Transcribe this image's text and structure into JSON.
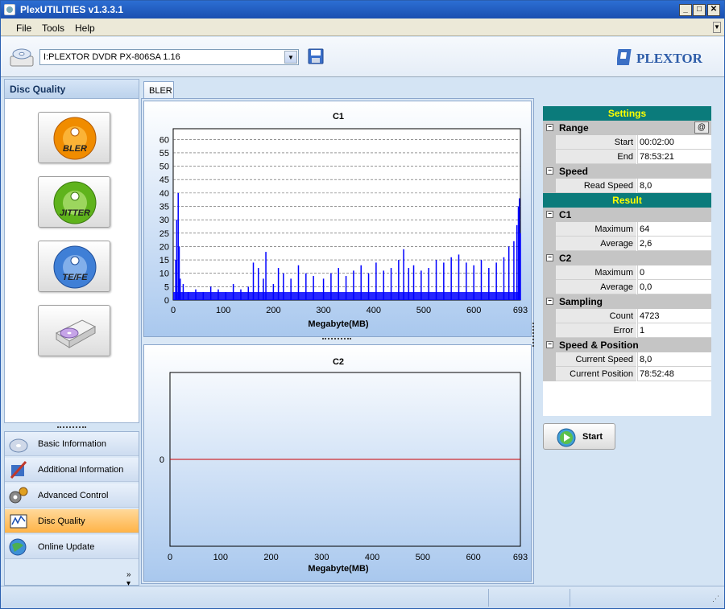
{
  "window": {
    "title": "PlexUTILITIES v1.3.3.1"
  },
  "menu": [
    "File",
    "Tools",
    "Help"
  ],
  "toolbar": {
    "drive": "I:PLEXTOR DVDR   PX-806SA   1.16",
    "logo_text": "PLEXTOR"
  },
  "left": {
    "header": "Disc Quality",
    "tests": [
      "BLER",
      "JITTER",
      "TE/FE"
    ],
    "nav": [
      {
        "label": "Basic Information",
        "icon": "cd-info-icon"
      },
      {
        "label": "Additional Information",
        "icon": "tools-icon"
      },
      {
        "label": "Advanced Control",
        "icon": "gears-icon"
      },
      {
        "label": "Disc Quality",
        "icon": "chart-icon",
        "active": true
      },
      {
        "label": "Online Update",
        "icon": "globe-icon"
      }
    ]
  },
  "tab": "BLER",
  "chart_data": [
    {
      "type": "bar",
      "title": "C1",
      "xlabel": "Megabyte(MB)",
      "ylabel": "",
      "xlim": [
        0,
        693
      ],
      "ylim": [
        0,
        64
      ],
      "xticks": [
        0,
        100,
        200,
        300,
        400,
        500,
        600,
        693
      ],
      "yticks": [
        0,
        5,
        10,
        15,
        20,
        25,
        30,
        35,
        40,
        45,
        50,
        55,
        60
      ],
      "grid": true,
      "color": "#0000ff",
      "spikes": [
        {
          "x": 5,
          "y": 15
        },
        {
          "x": 7,
          "y": 30
        },
        {
          "x": 10,
          "y": 40
        },
        {
          "x": 12,
          "y": 20
        },
        {
          "x": 14,
          "y": 8
        },
        {
          "x": 20,
          "y": 6
        },
        {
          "x": 30,
          "y": 3
        },
        {
          "x": 45,
          "y": 4
        },
        {
          "x": 60,
          "y": 3
        },
        {
          "x": 75,
          "y": 5
        },
        {
          "x": 90,
          "y": 4
        },
        {
          "x": 105,
          "y": 3
        },
        {
          "x": 120,
          "y": 6
        },
        {
          "x": 135,
          "y": 4
        },
        {
          "x": 150,
          "y": 5
        },
        {
          "x": 160,
          "y": 14
        },
        {
          "x": 170,
          "y": 12
        },
        {
          "x": 180,
          "y": 8
        },
        {
          "x": 185,
          "y": 18
        },
        {
          "x": 200,
          "y": 6
        },
        {
          "x": 210,
          "y": 12
        },
        {
          "x": 220,
          "y": 10
        },
        {
          "x": 235,
          "y": 8
        },
        {
          "x": 250,
          "y": 13
        },
        {
          "x": 265,
          "y": 10
        },
        {
          "x": 280,
          "y": 9
        },
        {
          "x": 300,
          "y": 8
        },
        {
          "x": 315,
          "y": 10
        },
        {
          "x": 330,
          "y": 12
        },
        {
          "x": 345,
          "y": 9
        },
        {
          "x": 360,
          "y": 11
        },
        {
          "x": 375,
          "y": 13
        },
        {
          "x": 390,
          "y": 10
        },
        {
          "x": 405,
          "y": 14
        },
        {
          "x": 420,
          "y": 11
        },
        {
          "x": 435,
          "y": 12
        },
        {
          "x": 450,
          "y": 15
        },
        {
          "x": 460,
          "y": 19
        },
        {
          "x": 470,
          "y": 12
        },
        {
          "x": 480,
          "y": 13
        },
        {
          "x": 495,
          "y": 11
        },
        {
          "x": 510,
          "y": 12
        },
        {
          "x": 525,
          "y": 15
        },
        {
          "x": 540,
          "y": 14
        },
        {
          "x": 555,
          "y": 16
        },
        {
          "x": 570,
          "y": 17
        },
        {
          "x": 585,
          "y": 14
        },
        {
          "x": 600,
          "y": 13
        },
        {
          "x": 615,
          "y": 15
        },
        {
          "x": 630,
          "y": 12
        },
        {
          "x": 645,
          "y": 14
        },
        {
          "x": 660,
          "y": 16
        },
        {
          "x": 670,
          "y": 20
        },
        {
          "x": 680,
          "y": 22
        },
        {
          "x": 686,
          "y": 28
        },
        {
          "x": 689,
          "y": 35
        },
        {
          "x": 691,
          "y": 38
        },
        {
          "x": 693,
          "y": 25
        }
      ],
      "baseline_noise": 3
    },
    {
      "type": "line",
      "title": "C2",
      "xlabel": "Megabyte(MB)",
      "xlim": [
        0,
        693
      ],
      "ylim": [
        -1,
        1
      ],
      "xticks": [
        0,
        100,
        200,
        300,
        400,
        500,
        600,
        693
      ],
      "yticks": [
        0
      ],
      "series": [
        {
          "x": [
            0,
            693
          ],
          "values": [
            0,
            0
          ]
        }
      ],
      "color": "#cc0000"
    }
  ],
  "settings": {
    "header": "Settings",
    "range_label": "Range",
    "at_label": "@",
    "start_label": "Start",
    "start_value": "00:02:00",
    "end_label": "End",
    "end_value": "78:53:21",
    "speed_label": "Speed",
    "read_speed_label": "Read Speed",
    "read_speed_value": "8,0"
  },
  "result": {
    "header": "Result",
    "c1_label": "C1",
    "c1_max_label": "Maximum",
    "c1_max": "64",
    "c1_avg_label": "Average",
    "c1_avg": "2,6",
    "c2_label": "C2",
    "c2_max_label": "Maximum",
    "c2_max": "0",
    "c2_avg_label": "Average",
    "c2_avg": "0,0",
    "sampling_label": "Sampling",
    "count_label": "Count",
    "count": "4723",
    "error_label": "Error",
    "error": "1",
    "speedpos_label": "Speed & Position",
    "cur_speed_label": "Current Speed",
    "cur_speed": "8,0",
    "cur_pos_label": "Current Position",
    "cur_pos": "78:52:48"
  },
  "start_button": "Start"
}
